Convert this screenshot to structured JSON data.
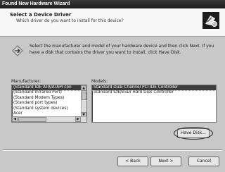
{
  "window": {
    "title": "Found New Hardware Wizard"
  },
  "header": {
    "title": "Select a Device Driver",
    "subtitle": "Which driver do you want to install for this device?",
    "icon": "hardware-wizard-icon"
  },
  "info": {
    "icon": "diamond-arrow-icon",
    "text": "Select the manufacturer and model of your hardware device and then click Next. If you have a disk that contains the driver you want to install, click Have Disk."
  },
  "manufacturers": {
    "label": "Manufacturer:",
    "items": [
      {
        "label": "(Standard IDE ATA/ATAPI con",
        "selected": true
      },
      {
        "label": "(Standard Infrared Port)",
        "selected": false
      },
      {
        "label": "(Standard Modem Types)",
        "selected": false
      },
      {
        "label": "(Standard port types)",
        "selected": false
      },
      {
        "label": "(Standard system devices)",
        "selected": false
      },
      {
        "label": "Acer",
        "selected": false
      }
    ]
  },
  "models": {
    "label": "Models:",
    "items": [
      {
        "label": "Standard Dual Channel PCI IDE Controller",
        "selected": true
      },
      {
        "label": "Standard IDE/ESDI Hard Disk Controller",
        "selected": false
      }
    ]
  },
  "buttons": {
    "have_disk": "Have Disk...",
    "back": "< Back",
    "next": "Next >",
    "cancel": "Cancel"
  }
}
